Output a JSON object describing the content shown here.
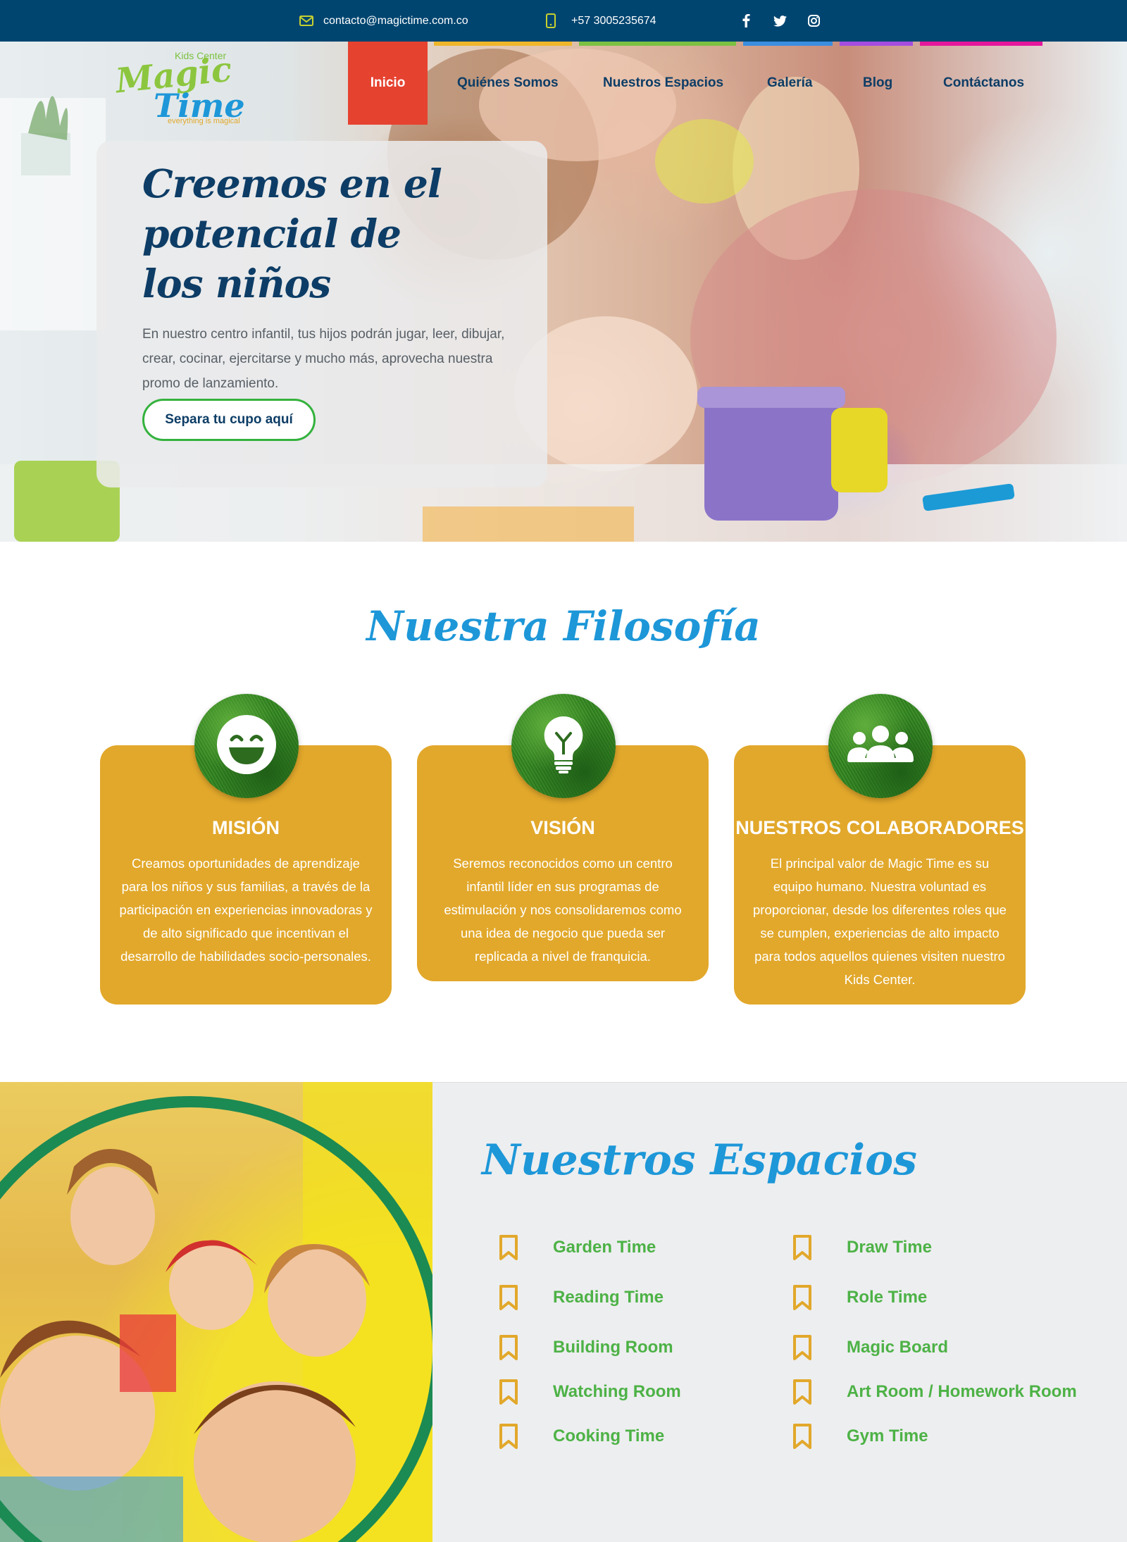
{
  "topbar": {
    "email": "contacto@magictime.com.co",
    "phone": "+57 3005235674",
    "email_icon": "envelope-icon",
    "phone_icon": "mobile-phone-icon",
    "social": [
      "facebook-icon",
      "twitter-icon",
      "instagram-icon"
    ],
    "accent_color": "#c7d12f"
  },
  "logo": {
    "line1": "Kids Center",
    "line2": "Magic",
    "line3": "Time",
    "tagline": "everything is magical"
  },
  "nav": {
    "items": [
      "Inicio",
      "Quiénes Somos",
      "Nuestros Espacios",
      "Galería",
      "Blog",
      "Contáctanos"
    ],
    "active": "Inicio",
    "active_color": "#e64230",
    "stripe_colors": [
      "#f0b62a",
      "#7cc142",
      "#3b8ee0",
      "#a54de0",
      "#e5179c"
    ]
  },
  "hero": {
    "title": "Creemos en el potencial de los niños",
    "text": "En nuestro centro infantil, tus hijos podrán jugar, leer, dibujar, crear, cocinar, ejercitarse y mucho más, aprovecha nuestra promo de lanzamiento.",
    "button": "Separa tu cupo aquí"
  },
  "philosophy": {
    "title": "Nuestra Filosofía",
    "cards": [
      {
        "icon": "smiley-face-icon",
        "title": "MISIÓN",
        "text": "Creamos oportunidades de aprendizaje para los niños y sus familias, a través de la participación en experiencias innovadoras y de alto significado que incentivan el desarrollo de habilidades socio-personales."
      },
      {
        "icon": "lightbulb-icon",
        "title": "VISIÓN",
        "text": "Seremos reconocidos como un centro infantil líder en sus programas de estimulación y nos consolidaremos como una idea de negocio que pueda ser replicada a nivel de franquicia."
      },
      {
        "icon": "group-people-icon",
        "title": "NUESTROS COLABORADORES",
        "text": "El principal valor de Magic Time es su equipo humano. Nuestra voluntad es proporcionar, desde los diferentes roles que se cumplen, experiencias de alto impacto para todos aquellos quienes visiten nuestro Kids Center."
      }
    ],
    "card_color": "#e2a82b"
  },
  "spaces": {
    "title": "Nuestros Espacios",
    "left": [
      "Garden Time",
      "Reading Time",
      "Building Room",
      "Watching Room",
      "Cooking Time"
    ],
    "right": [
      "Draw Time",
      "Role Time",
      "Magic Board",
      "Art Room / Homework Room",
      "Gym Time"
    ],
    "item_icon": "bookmark-icon",
    "item_color": "#4db246",
    "icon_color": "#e2a82b"
  }
}
